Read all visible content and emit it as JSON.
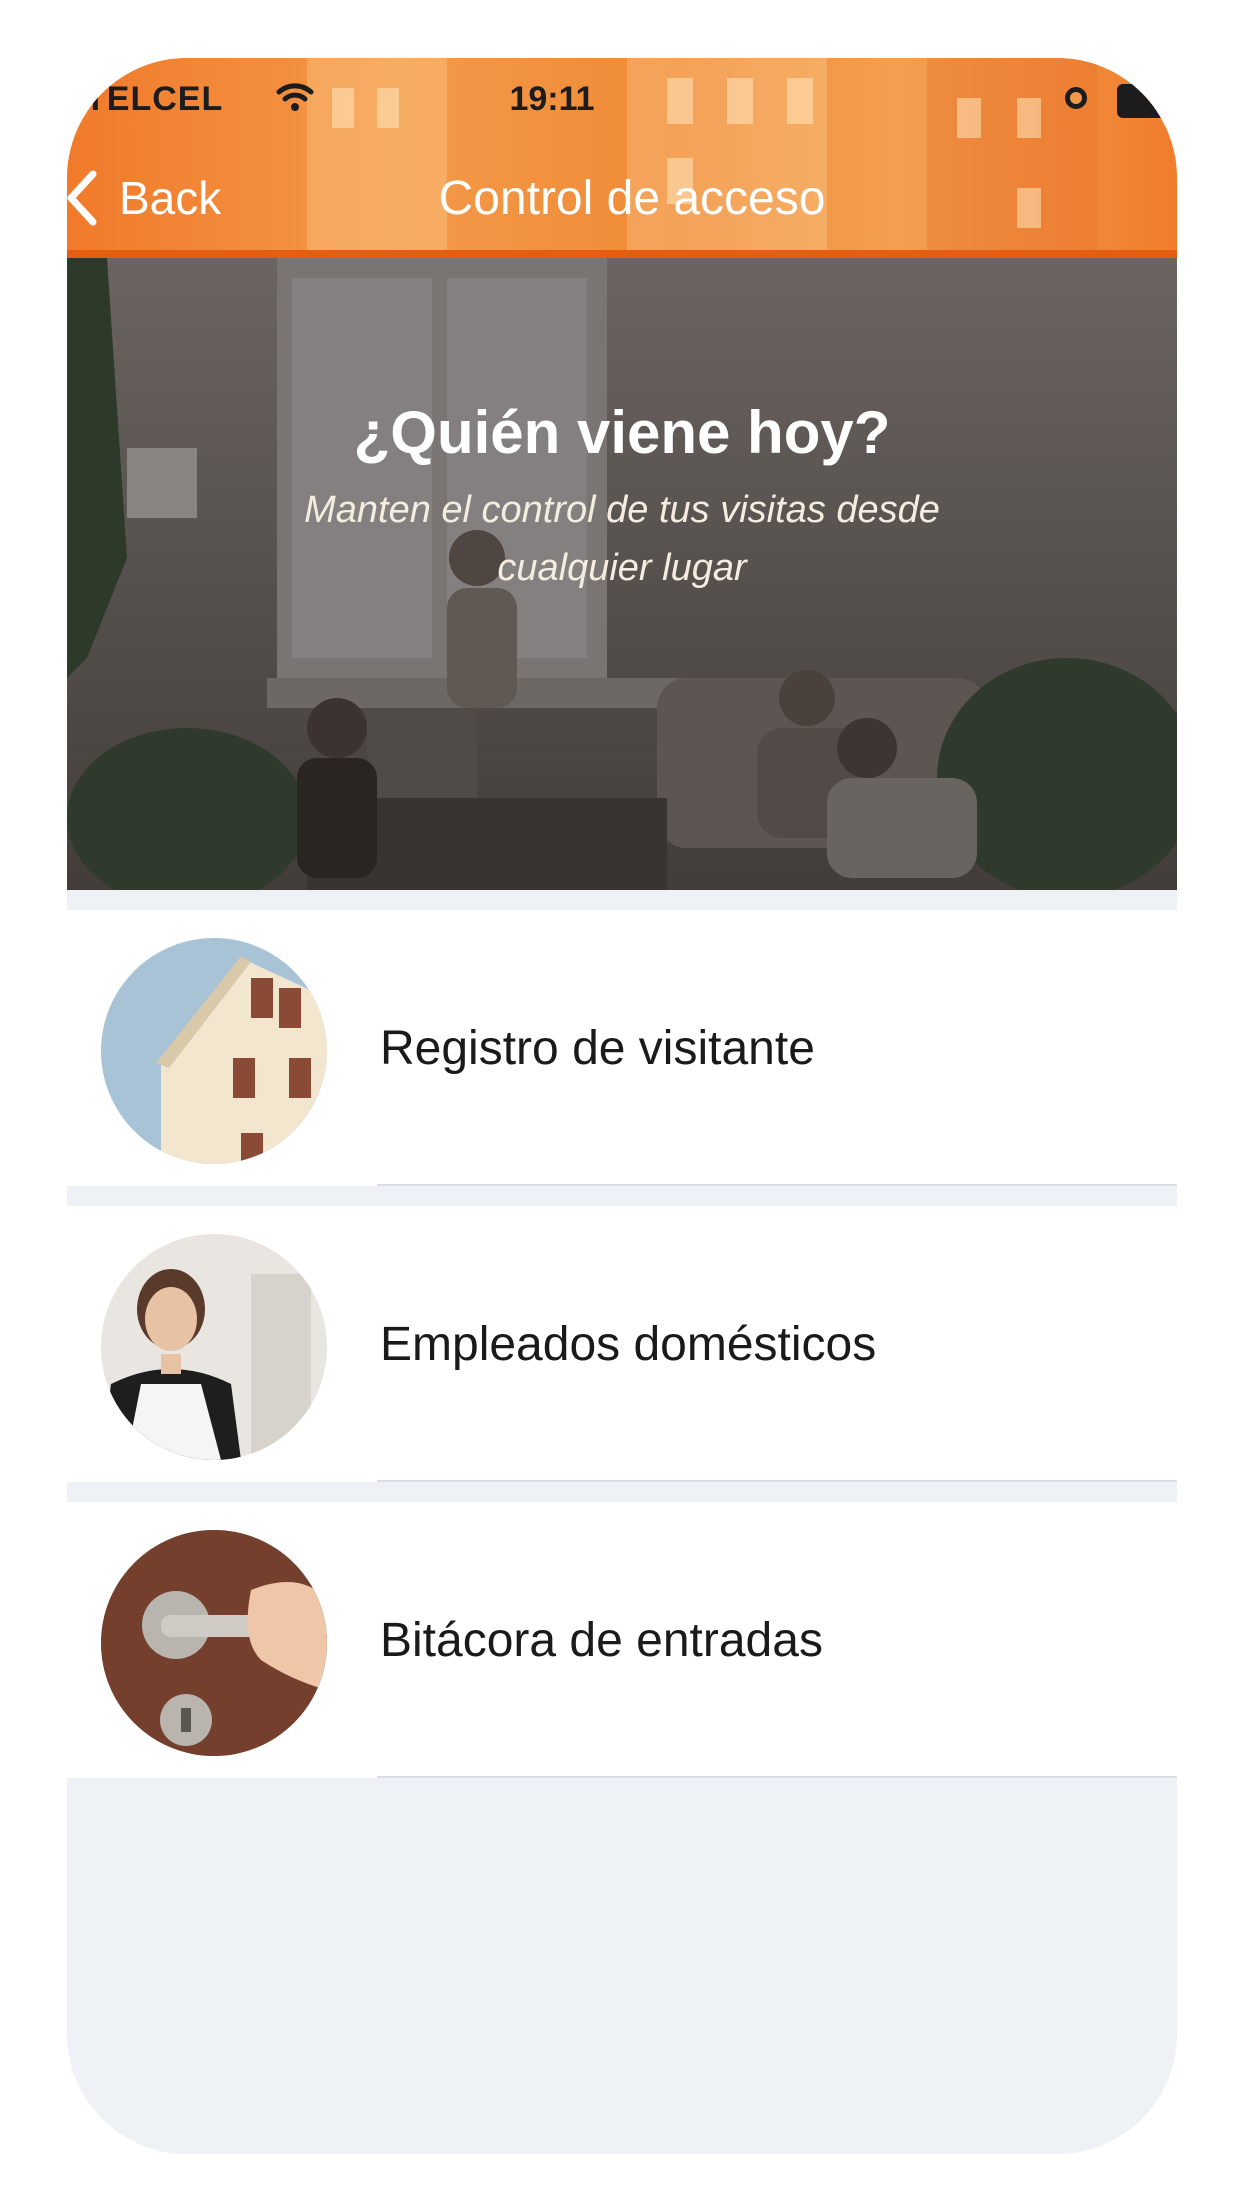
{
  "status_bar": {
    "carrier": "TELCEL",
    "time": "19:11"
  },
  "nav": {
    "back_label": "Back",
    "title": "Control de acceso"
  },
  "hero": {
    "title": "¿Quién viene hoy?",
    "subtitle": "Manten el control de tus visitas desde cualquier lugar"
  },
  "menu": {
    "items": [
      {
        "label": "Registro de visitante",
        "icon": "building-icon"
      },
      {
        "label": "Empleados domésticos",
        "icon": "housekeeper-icon"
      },
      {
        "label": "Bitácora de entradas",
        "icon": "door-handle-icon"
      }
    ]
  },
  "colors": {
    "header_orange": "#f07a2a",
    "background": "#eef1f6"
  }
}
